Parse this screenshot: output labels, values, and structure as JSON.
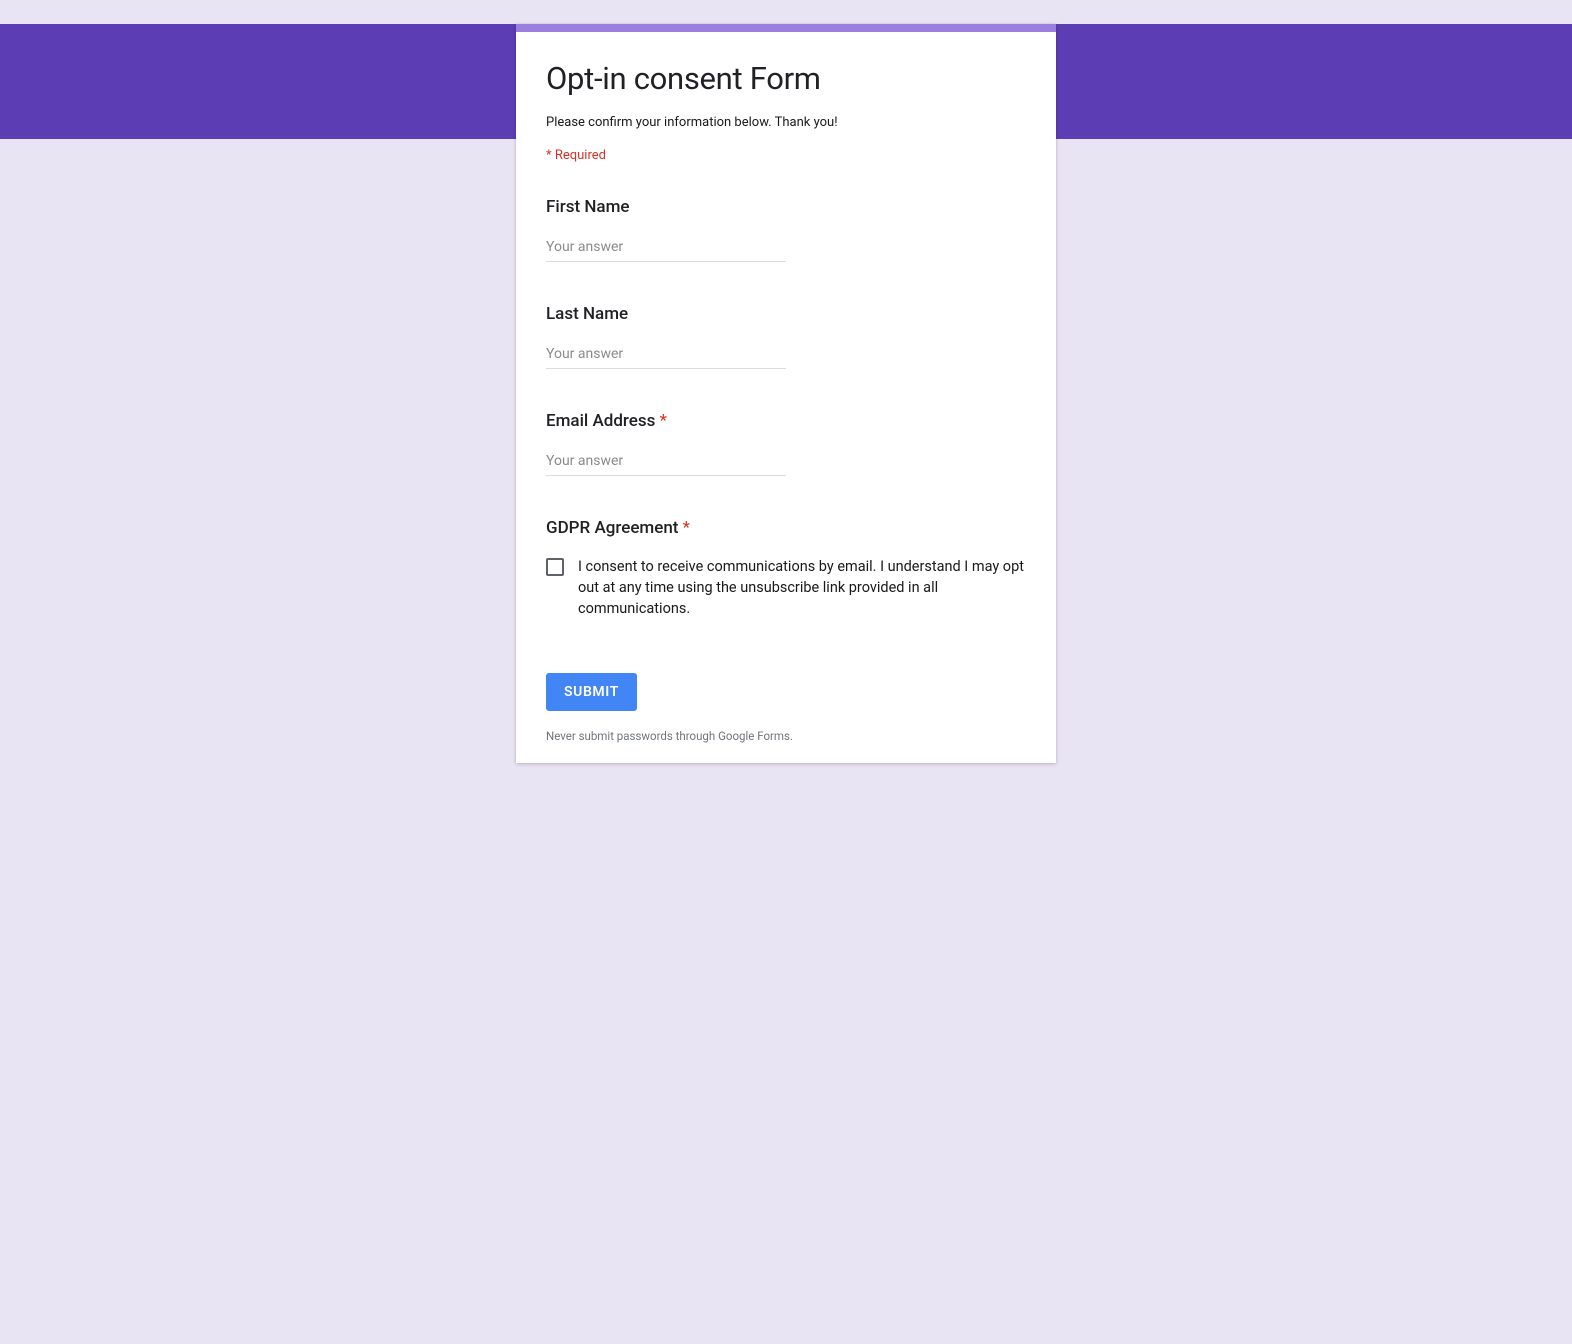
{
  "form": {
    "title": "Opt-in consent Form",
    "description": "Please confirm your information below. Thank you!",
    "required_note": "* Required",
    "fields": {
      "first_name": {
        "label": "First Name",
        "placeholder": "Your answer",
        "required": false
      },
      "last_name": {
        "label": "Last Name",
        "placeholder": "Your answer",
        "required": false
      },
      "email": {
        "label": "Email Address",
        "placeholder": "Your answer",
        "required": true
      },
      "gdpr": {
        "label": "GDPR Agreement",
        "required": true,
        "checkbox_text": "I consent to receive communications by email. I understand I may opt out at any time using the unsubscribe link provided in all communications."
      }
    },
    "submit_label": "SUBMIT",
    "footer_note": "Never submit passwords through Google Forms.",
    "asterisk": " *"
  }
}
